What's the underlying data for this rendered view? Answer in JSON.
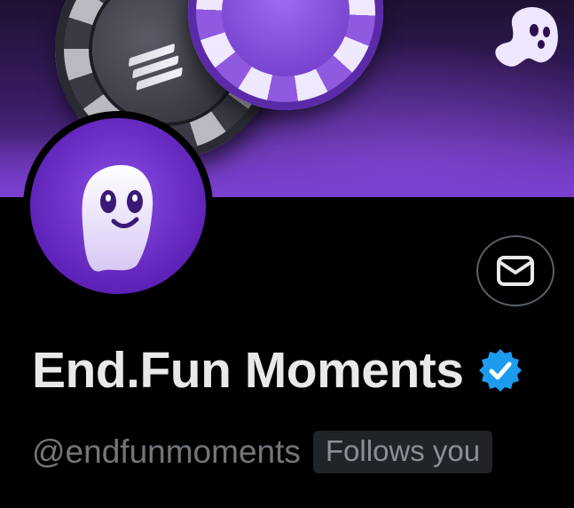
{
  "profile": {
    "display_name": "End.Fun Moments",
    "handle": "@endfunmoments",
    "follows_you_label": "Follows you",
    "verified": true
  },
  "icons": {
    "message": "envelope-icon",
    "verified": "verified-badge-icon",
    "avatar": "ghost-icon",
    "banner_coin": "solana-logo-icon"
  },
  "colors": {
    "background": "#000000",
    "banner_purple": "#6b36b4",
    "avatar_purple": "#6a2fc9",
    "verified_blue": "#1d9bf0",
    "name_text": "#e7e9ea",
    "secondary_text": "#71767b",
    "badge_bg": "#202327"
  }
}
